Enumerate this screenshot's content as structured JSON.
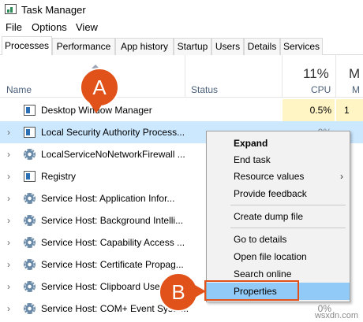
{
  "window": {
    "title": "Task Manager"
  },
  "menu": [
    "File",
    "Options",
    "View"
  ],
  "tabs": [
    "Processes",
    "Performance",
    "App history",
    "Startup",
    "Users",
    "Details",
    "Services"
  ],
  "columns": {
    "name": "Name",
    "status": "Status",
    "cpu_percent": "11%",
    "cpu": "CPU",
    "mem_percent": "M",
    "mem": "M"
  },
  "rows": [
    {
      "name": "Desktop Window Manager",
      "cpu": "0.5%",
      "mem": "1"
    },
    {
      "name": "Local Security Authority Process...",
      "cpu": "0%",
      "mem": ""
    },
    {
      "name": "LocalServiceNoNetworkFirewall ...",
      "cpu": "",
      "mem": ""
    },
    {
      "name": "Registry",
      "cpu": "",
      "mem": ""
    },
    {
      "name": "Service Host: Application Infor...",
      "cpu": "",
      "mem": ""
    },
    {
      "name": "Service Host: Background Intelli...",
      "cpu": "",
      "mem": ""
    },
    {
      "name": "Service Host: Capability Access ...",
      "cpu": "",
      "mem": ""
    },
    {
      "name": "Service Host: Certificate Propag...",
      "cpu": "",
      "mem": ""
    },
    {
      "name": "Service Host: Clipboard User...",
      "cpu": "",
      "mem": ""
    },
    {
      "name": "Service Host: COM+ Event Syste...",
      "cpu": "0%",
      "mem": ""
    }
  ],
  "context_menu": {
    "expand": "Expand",
    "end_task": "End task",
    "resource_values": "Resource values",
    "provide_feedback": "Provide feedback",
    "create_dump": "Create dump file",
    "go_to_details": "Go to details",
    "open_file_location": "Open file location",
    "search_online": "Search online",
    "properties": "Properties"
  },
  "callouts": {
    "a": "A",
    "b": "B"
  },
  "watermark": "wsxdn.com"
}
